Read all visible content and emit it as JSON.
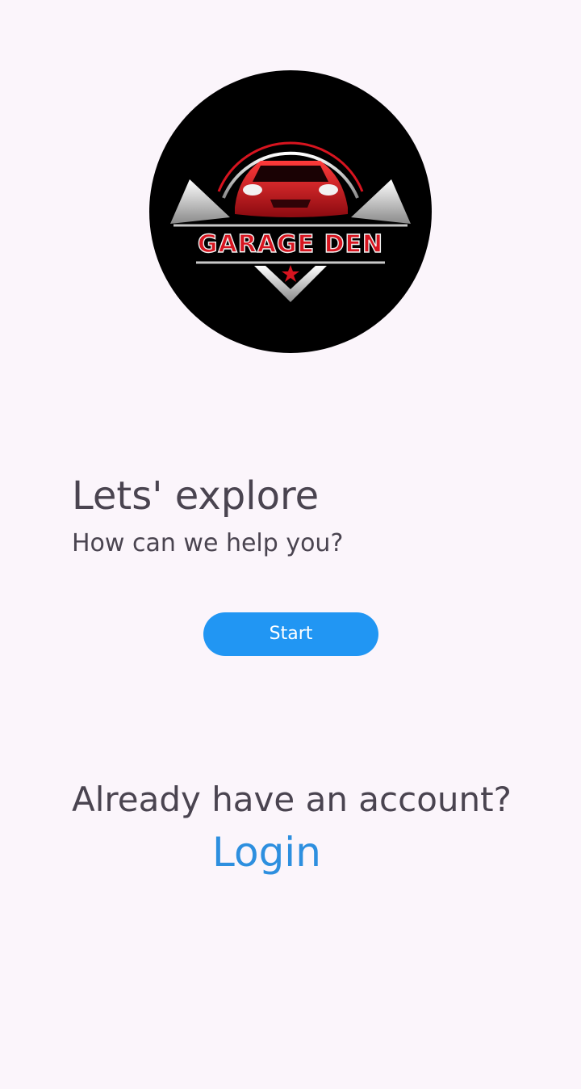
{
  "logo": {
    "brand_text": "GARAGE DEN",
    "colors": {
      "background": "#000000",
      "accent": "#d7141f",
      "silver": "#c8c8c8"
    }
  },
  "welcome": {
    "title": "Lets' explore",
    "subtitle": "How can we help you?"
  },
  "start_button": {
    "label": "Start",
    "color": "#2196f3"
  },
  "account": {
    "prompt": "Already have an account?",
    "login_label": "Login",
    "link_color": "#2d8fdf"
  }
}
